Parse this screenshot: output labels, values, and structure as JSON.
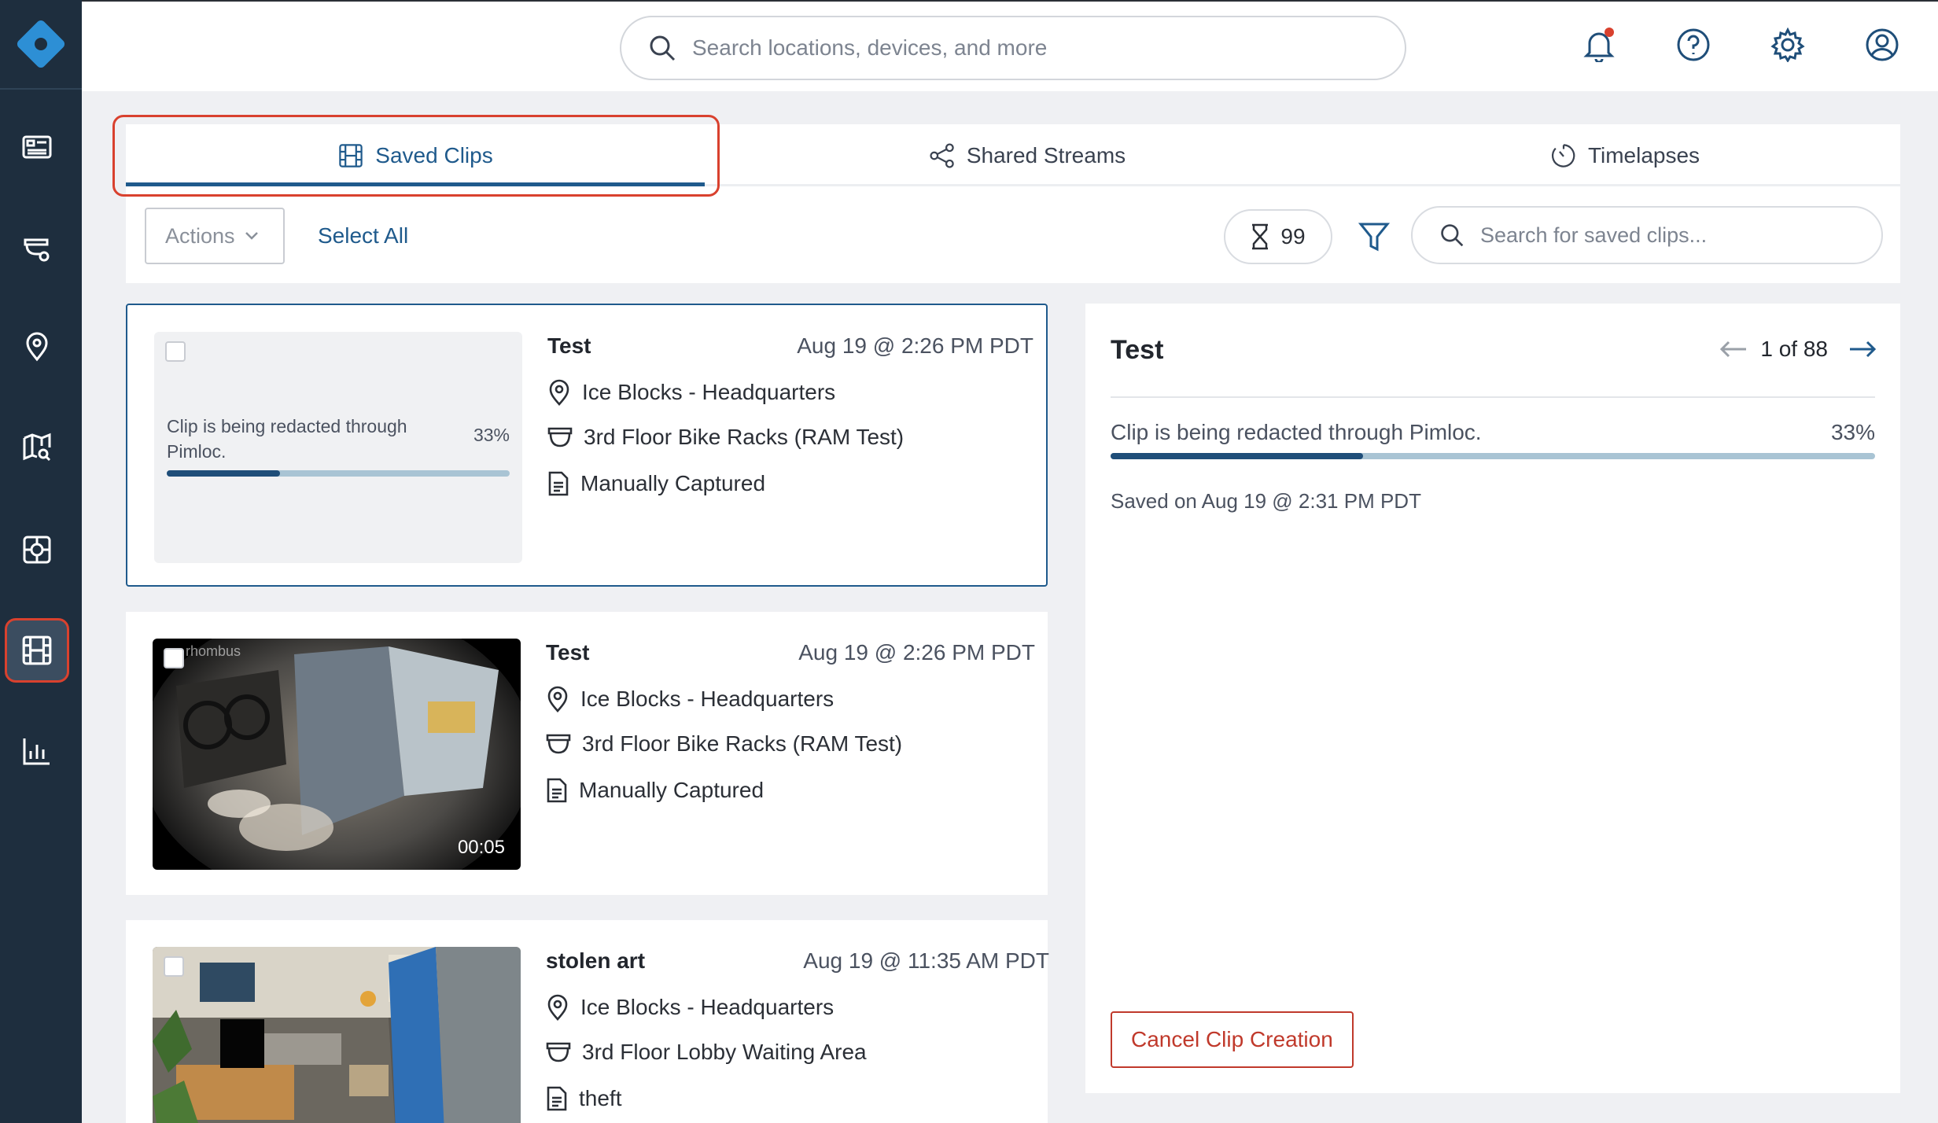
{
  "search": {
    "placeholder": "Search locations, devices, and more"
  },
  "tabs": [
    {
      "label": "Saved Clips",
      "icon": "film-icon"
    },
    {
      "label": "Shared Streams",
      "icon": "share-icon"
    },
    {
      "label": "Timelapses",
      "icon": "timer-icon"
    }
  ],
  "toolbar": {
    "actions_label": "Actions",
    "select_all_label": "Select All",
    "pending_count": "99",
    "clip_search_placeholder": "Search for saved clips..."
  },
  "clips": [
    {
      "title": "Test",
      "date": "Aug 19 @ 2:26 PM PDT",
      "location": "Ice Blocks - Headquarters",
      "camera": "3rd Floor Bike Racks (RAM Test)",
      "note": "Manually Captured",
      "redact_text": "Clip is being redacted through Pimloc.",
      "redact_percent": "33%",
      "progress": 0.33
    },
    {
      "title": "Test",
      "date": "Aug 19 @ 2:26 PM PDT",
      "location": "Ice Blocks - Headquarters",
      "camera": "3rd Floor Bike Racks (RAM Test)",
      "note": "Manually Captured",
      "duration": "00:05",
      "watermark": "rhombus"
    },
    {
      "title": "stolen art",
      "date": "Aug 19 @ 11:35 AM PDT",
      "location": "Ice Blocks - Headquarters",
      "camera": "3rd Floor Lobby Waiting Area",
      "note": "theft"
    }
  ],
  "detail": {
    "title": "Test",
    "pager": "1 of 88",
    "redact_text": "Clip is being redacted through Pimloc.",
    "redact_percent": "33%",
    "progress": 0.33,
    "saved_on": "Saved on Aug 19 @ 2:31 PM PDT",
    "cancel_label": "Cancel Clip Creation"
  },
  "colors": {
    "sidebar_bg": "#1e2e3e",
    "accent_blue": "#1f5a8c",
    "highlight_red": "#d9412e"
  }
}
